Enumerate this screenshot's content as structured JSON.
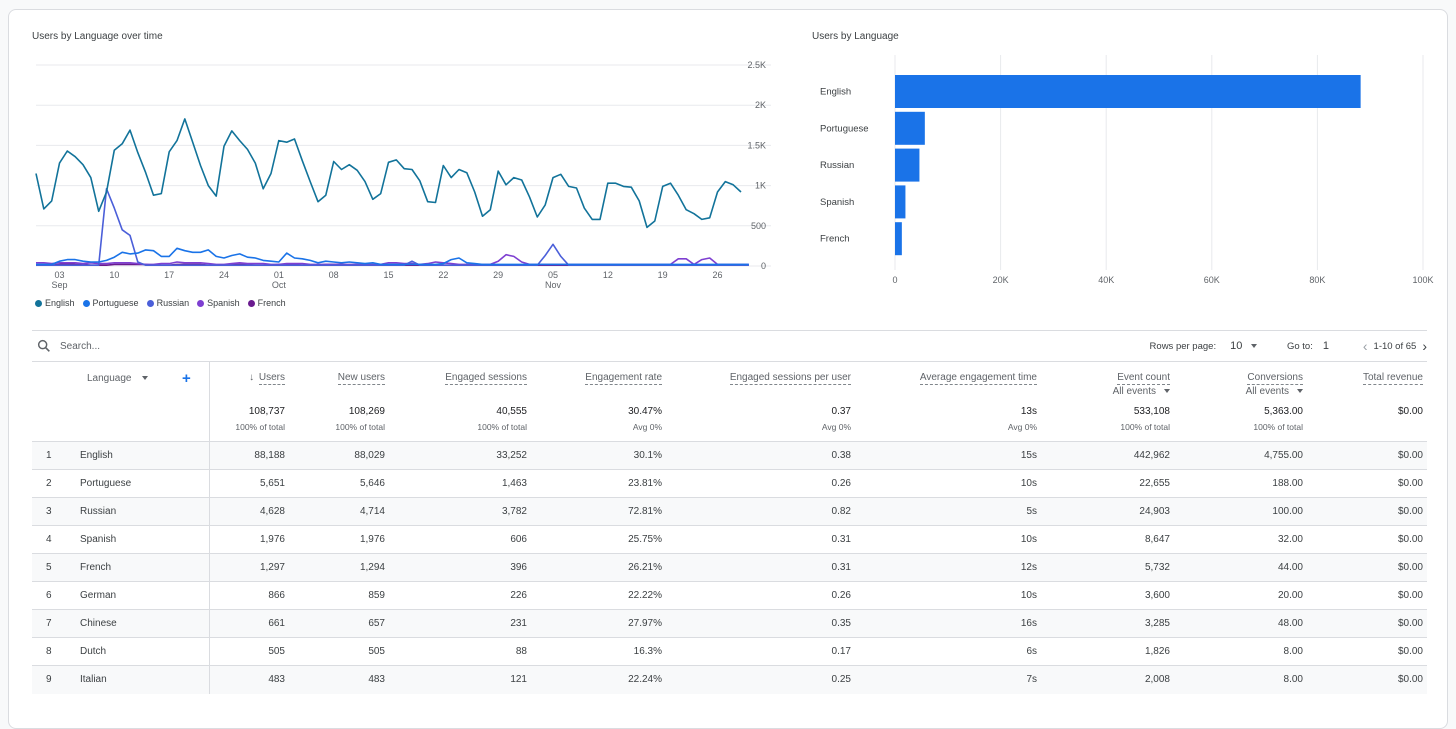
{
  "line_chart": {
    "title": "Users by Language over time"
  },
  "bar_chart": {
    "title": "Users by Language"
  },
  "chart_data": [
    {
      "type": "line",
      "title": "Users by Language over time",
      "xlabel": "",
      "ylabel": "",
      "ylim": [
        0,
        2500
      ],
      "y_ticks": [
        "0",
        "500",
        "1K",
        "1.5K",
        "2K",
        "2.5K"
      ],
      "y_tick_values": [
        0,
        500,
        1000,
        1500,
        2000,
        2500
      ],
      "x_start": "Aug 31",
      "x_ticks": [
        {
          "day": 3,
          "label": "03",
          "sub": "Sep"
        },
        {
          "day": 10,
          "label": "10",
          "sub": ""
        },
        {
          "day": 17,
          "label": "17",
          "sub": ""
        },
        {
          "day": 24,
          "label": "24",
          "sub": ""
        },
        {
          "day": 31,
          "label": "01",
          "sub": "Oct"
        },
        {
          "day": 38,
          "label": "08",
          "sub": ""
        },
        {
          "day": 45,
          "label": "15",
          "sub": ""
        },
        {
          "day": 52,
          "label": "22",
          "sub": ""
        },
        {
          "day": 59,
          "label": "29",
          "sub": ""
        },
        {
          "day": 66,
          "label": "05",
          "sub": "Nov"
        },
        {
          "day": 73,
          "label": "12",
          "sub": ""
        },
        {
          "day": 80,
          "label": "19",
          "sub": ""
        },
        {
          "day": 87,
          "label": "26",
          "sub": ""
        }
      ],
      "grid": true,
      "legend_position": "bottom-left",
      "series": [
        {
          "name": "English",
          "color": "#12739a",
          "values": [
            1150,
            710,
            810,
            1280,
            1430,
            1360,
            1260,
            1100,
            680,
            920,
            1440,
            1520,
            1690,
            1410,
            1160,
            880,
            900,
            1420,
            1560,
            1830,
            1540,
            1250,
            1000,
            870,
            1490,
            1680,
            1560,
            1450,
            1280,
            960,
            1150,
            1560,
            1540,
            1580,
            1310,
            1050,
            800,
            880,
            1300,
            1200,
            1260,
            1190,
            1050,
            830,
            900,
            1290,
            1320,
            1210,
            1200,
            1060,
            800,
            790,
            1250,
            1100,
            1200,
            1160,
            920,
            620,
            700,
            1180,
            1010,
            1100,
            1070,
            860,
            610,
            760,
            1100,
            1140,
            990,
            970,
            720,
            580,
            580,
            1030,
            1030,
            990,
            980,
            810,
            480,
            560,
            990,
            1030,
            880,
            700,
            650,
            580,
            600,
            920,
            1050,
            1010,
            920
          ]
        },
        {
          "name": "Portuguese",
          "color": "#1a73e8",
          "values": [
            20,
            20,
            20,
            60,
            80,
            80,
            60,
            50,
            50,
            70,
            110,
            170,
            150,
            160,
            200,
            190,
            120,
            120,
            220,
            190,
            170,
            170,
            200,
            120,
            100,
            130,
            150,
            110,
            100,
            70,
            60,
            50,
            160,
            100,
            90,
            70,
            40,
            60,
            50,
            40,
            50,
            40,
            30,
            40,
            20,
            20,
            20,
            20,
            20,
            20,
            20,
            20,
            30,
            80,
            100,
            40,
            30,
            20,
            20,
            20,
            20,
            20,
            20,
            20,
            20,
            20,
            20,
            20,
            20,
            20,
            20,
            20,
            20,
            20,
            20,
            20,
            20,
            20,
            20,
            20,
            20,
            20,
            20,
            20,
            20,
            20,
            20,
            20,
            20,
            20,
            20,
            20
          ]
        },
        {
          "name": "Russian",
          "color": "#4b5fd9",
          "values": [
            10,
            10,
            10,
            10,
            10,
            10,
            10,
            10,
            10,
            960,
            720,
            450,
            380,
            50,
            10,
            10,
            10,
            10,
            10,
            10,
            10,
            10,
            10,
            10,
            10,
            10,
            10,
            10,
            10,
            10,
            10,
            10,
            10,
            10,
            10,
            10,
            10,
            10,
            10,
            10,
            10,
            10,
            10,
            10,
            10,
            10,
            10,
            10,
            60,
            10,
            10,
            10,
            10,
            10,
            10,
            10,
            10,
            10,
            10,
            10,
            10,
            10,
            10,
            10,
            10,
            130,
            270,
            120,
            10,
            10,
            10,
            10,
            10,
            10,
            10,
            10,
            10,
            10,
            10,
            10,
            10,
            10,
            10,
            10,
            10,
            10,
            10,
            10,
            10,
            10,
            10,
            10
          ]
        },
        {
          "name": "Spanish",
          "color": "#7e3fd1",
          "values": [
            40,
            40,
            30,
            40,
            40,
            40,
            30,
            40,
            30,
            30,
            40,
            40,
            40,
            30,
            20,
            20,
            30,
            30,
            50,
            40,
            40,
            40,
            30,
            20,
            20,
            30,
            40,
            30,
            30,
            30,
            20,
            20,
            30,
            30,
            30,
            20,
            20,
            20,
            20,
            20,
            20,
            20,
            20,
            20,
            20,
            40,
            40,
            30,
            30,
            20,
            30,
            50,
            40,
            30,
            20,
            20,
            20,
            20,
            20,
            60,
            140,
            120,
            50,
            20,
            20,
            20,
            20,
            20,
            20,
            20,
            20,
            20,
            20,
            20,
            20,
            20,
            20,
            20,
            20,
            20,
            20,
            20,
            90,
            90,
            20,
            80,
            100,
            20,
            20,
            20,
            20,
            20
          ]
        },
        {
          "name": "French",
          "color": "#6a1b8f",
          "values": [
            10,
            10,
            10,
            20,
            30,
            20,
            20,
            10,
            10,
            10,
            20,
            20,
            20,
            20,
            20,
            10,
            10,
            10,
            20,
            20,
            20,
            20,
            10,
            10,
            10,
            20,
            20,
            20,
            10,
            10,
            10,
            20,
            20,
            20,
            10,
            10,
            10,
            20,
            20,
            20,
            10,
            10,
            10,
            10,
            10,
            10,
            10,
            10,
            10,
            10,
            10,
            10,
            10,
            10,
            10,
            10,
            10,
            10,
            10,
            10,
            10,
            10,
            10,
            10,
            10,
            10,
            10,
            10,
            10,
            10,
            10,
            10,
            10,
            10,
            10,
            10,
            10,
            10,
            10,
            10,
            10,
            10,
            10,
            10,
            10,
            10,
            10,
            10,
            10,
            10,
            10,
            10
          ]
        }
      ]
    },
    {
      "type": "bar",
      "orientation": "horizontal",
      "title": "Users by Language",
      "categories": [
        "English",
        "Portuguese",
        "Russian",
        "Spanish",
        "French"
      ],
      "values": [
        88188,
        5651,
        4628,
        1976,
        1297
      ],
      "color": "#1a73e8",
      "xlim": [
        0,
        100000
      ],
      "x_ticks": [
        "0",
        "20K",
        "40K",
        "60K",
        "80K",
        "100K"
      ],
      "x_tick_values": [
        0,
        20000,
        40000,
        60000,
        80000,
        100000
      ],
      "grid": true
    }
  ],
  "toolbar": {
    "search_placeholder": "Search...",
    "rows_per_page_label": "Rows per page:",
    "rows_per_page_value": "10",
    "goto_label": "Go to:",
    "goto_value": "1",
    "range_text": "1-10 of 65"
  },
  "table": {
    "dimension_header": "Language",
    "columns": [
      {
        "label": "Users",
        "sorted": true,
        "sub": "",
        "total": "108,737",
        "total_sub": "100% of total"
      },
      {
        "label": "New users",
        "sub": "",
        "total": "108,269",
        "total_sub": "100% of total"
      },
      {
        "label": "Engaged sessions",
        "sub": "",
        "total": "40,555",
        "total_sub": "100% of total"
      },
      {
        "label": "Engagement rate",
        "sub": "",
        "total": "30.47%",
        "total_sub": "Avg 0%"
      },
      {
        "label": "Engaged sessions per user",
        "sub": "",
        "total": "0.37",
        "total_sub": "Avg 0%"
      },
      {
        "label": "Average engagement time",
        "sub": "",
        "total": "13s",
        "total_sub": "Avg 0%"
      },
      {
        "label": "Event count",
        "sub": "All events",
        "total": "533,108",
        "total_sub": "100% of total"
      },
      {
        "label": "Conversions",
        "sub": "All events",
        "total": "5,363.00",
        "total_sub": "100% of total"
      },
      {
        "label": "Total revenue",
        "sub": "",
        "total": "$0.00",
        "total_sub": ""
      }
    ],
    "rows": [
      {
        "idx": "1",
        "lang": "English",
        "cells": [
          "88,188",
          "88,029",
          "33,252",
          "30.1%",
          "0.38",
          "15s",
          "442,962",
          "4,755.00",
          "$0.00"
        ]
      },
      {
        "idx": "2",
        "lang": "Portuguese",
        "cells": [
          "5,651",
          "5,646",
          "1,463",
          "23.81%",
          "0.26",
          "10s",
          "22,655",
          "188.00",
          "$0.00"
        ]
      },
      {
        "idx": "3",
        "lang": "Russian",
        "cells": [
          "4,628",
          "4,714",
          "3,782",
          "72.81%",
          "0.82",
          "5s",
          "24,903",
          "100.00",
          "$0.00"
        ]
      },
      {
        "idx": "4",
        "lang": "Spanish",
        "cells": [
          "1,976",
          "1,976",
          "606",
          "25.75%",
          "0.31",
          "10s",
          "8,647",
          "32.00",
          "$0.00"
        ]
      },
      {
        "idx": "5",
        "lang": "French",
        "cells": [
          "1,297",
          "1,294",
          "396",
          "26.21%",
          "0.31",
          "12s",
          "5,732",
          "44.00",
          "$0.00"
        ]
      },
      {
        "idx": "6",
        "lang": "German",
        "cells": [
          "866",
          "859",
          "226",
          "22.22%",
          "0.26",
          "10s",
          "3,600",
          "20.00",
          "$0.00"
        ]
      },
      {
        "idx": "7",
        "lang": "Chinese",
        "cells": [
          "661",
          "657",
          "231",
          "27.97%",
          "0.35",
          "16s",
          "3,285",
          "48.00",
          "$0.00"
        ]
      },
      {
        "idx": "8",
        "lang": "Dutch",
        "cells": [
          "505",
          "505",
          "88",
          "16.3%",
          "0.17",
          "6s",
          "1,826",
          "8.00",
          "$0.00"
        ]
      },
      {
        "idx": "9",
        "lang": "Italian",
        "cells": [
          "483",
          "483",
          "121",
          "22.24%",
          "0.25",
          "7s",
          "2,008",
          "8.00",
          "$0.00"
        ]
      }
    ]
  }
}
